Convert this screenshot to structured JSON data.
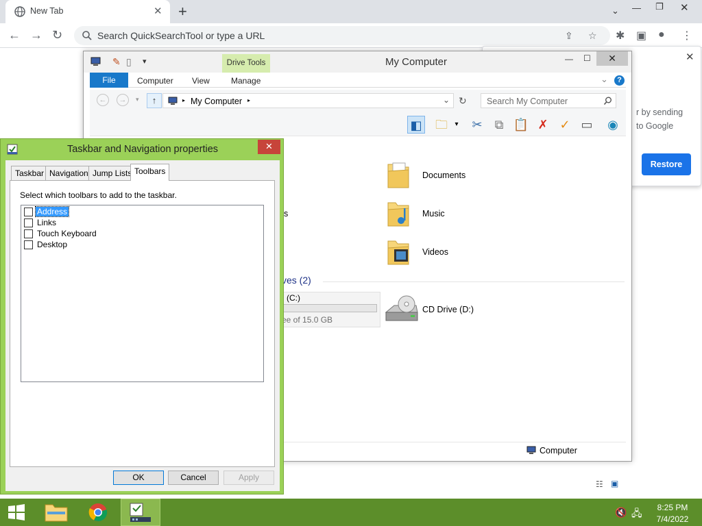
{
  "browser": {
    "tab_title": "New Tab",
    "omnibox_placeholder": "Search QuickSearchTool or type a URL"
  },
  "restore_popup": {
    "line1": "r by sending",
    "line2": "to Google",
    "button": "Restore",
    "button_color": "#1a73e8"
  },
  "explorer": {
    "title": "My Computer",
    "context_tab": "Drive Tools",
    "ribbon_tabs": [
      "File",
      "Computer",
      "View",
      "Manage"
    ],
    "address": "My Computer",
    "search_placeholder": "Search My Computer",
    "folders": [
      "Documents",
      "Music",
      "Videos"
    ],
    "partial_folder_suffix": "s",
    "drives_header": "ves (2)",
    "c_drive_name": "(C:)",
    "c_drive_free": "ee of 15.0 GB",
    "c_drive_used_fraction": 0.0,
    "cd_drive_name": "CD Drive (D:)",
    "status_location": "Computer",
    "accent": "#1979ca"
  },
  "dialog": {
    "title": "Taskbar and Navigation properties",
    "tabs": [
      "Taskbar",
      "Navigation",
      "Jump Lists",
      "Toolbars"
    ],
    "active_tab": "Toolbars",
    "instruction": "Select which toolbars to add to the taskbar.",
    "toolbars": [
      {
        "label": "Address",
        "checked": false,
        "selected": true
      },
      {
        "label": "Links",
        "checked": false,
        "selected": false
      },
      {
        "label": "Touch Keyboard",
        "checked": false,
        "selected": false
      },
      {
        "label": "Desktop",
        "checked": false,
        "selected": false
      }
    ],
    "buttons": {
      "ok": "OK",
      "cancel": "Cancel",
      "apply": "Apply"
    },
    "frame_color": "#9bd158"
  },
  "taskbar": {
    "time": "8:25 PM",
    "date": "7/4/2022",
    "color": "#5c8e2a"
  }
}
